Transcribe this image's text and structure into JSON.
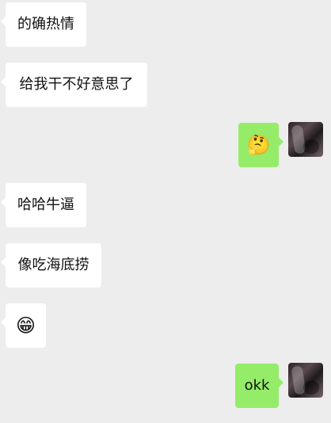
{
  "messages": [
    {
      "side": "left",
      "type": "text",
      "text": "的确热情"
    },
    {
      "side": "left",
      "type": "text",
      "text": "给我干不好意思了"
    },
    {
      "side": "right",
      "type": "emoji",
      "emoji": "🤔"
    },
    {
      "side": "left",
      "type": "text",
      "text": "哈哈牛逼"
    },
    {
      "side": "left",
      "type": "text",
      "text": "像吃海底捞"
    },
    {
      "side": "left",
      "type": "emoji",
      "emoji": "😁"
    },
    {
      "side": "right",
      "type": "text",
      "text": "okk"
    }
  ],
  "colors": {
    "background": "#ededed",
    "left_bubble": "#ffffff",
    "right_bubble": "#95ec69",
    "text": "#111111"
  }
}
